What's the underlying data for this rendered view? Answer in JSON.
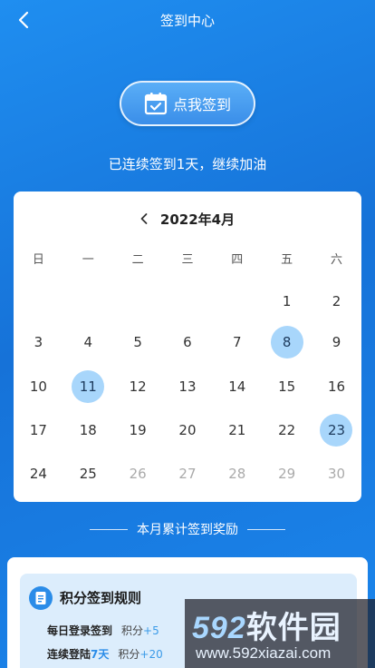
{
  "header": {
    "title": "签到中心"
  },
  "checkin": {
    "label": "点我签到"
  },
  "streak": {
    "text": "已连续签到1天，继续加油"
  },
  "calendar": {
    "month_title": "2022年4月",
    "weekdays": [
      "日",
      "一",
      "二",
      "三",
      "四",
      "五",
      "六"
    ],
    "weeks": [
      [
        "",
        "",
        "",
        "",
        "",
        "1",
        "2"
      ],
      [
        "3",
        "4",
        "5",
        "6",
        "7",
        "8",
        "9"
      ],
      [
        "10",
        "11",
        "12",
        "13",
        "14",
        "15",
        "16"
      ],
      [
        "17",
        "18",
        "19",
        "20",
        "21",
        "22",
        "23"
      ],
      [
        "24",
        "25",
        "26",
        "27",
        "28",
        "29",
        "30"
      ]
    ],
    "signed_days": [
      "8",
      "11",
      "23"
    ],
    "future_days": [
      "26",
      "27",
      "28",
      "29",
      "30"
    ]
  },
  "reward": {
    "title": "本月累计签到奖励"
  },
  "rules": {
    "heading": "积分签到规则",
    "daily_login": {
      "name": "每日登录签到",
      "points_label": "积分",
      "points_value": "+5"
    },
    "consecutive": {
      "name": "连续登陆",
      "days": "7天",
      "points_label": "积分",
      "points_value": "+20"
    }
  },
  "watermark": {
    "logo_num": "592",
    "logo_text": "软件园",
    "url": "www.592xiazai.com"
  },
  "colors": {
    "accent": "#2a8ce8",
    "signed": "#a8d6fb",
    "bg": "#1672d8"
  }
}
